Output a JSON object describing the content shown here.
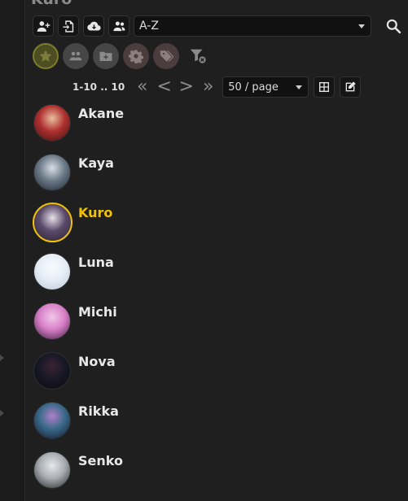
{
  "window": {
    "title": "Kuro"
  },
  "toolbar": {
    "sort_value": "A-Z",
    "buttons": [
      "add-user-icon",
      "import-icon",
      "cloud-download-icon",
      "group-icon"
    ]
  },
  "filters": {
    "tags": [
      {
        "name": "favorite",
        "icon": "star-icon",
        "color": "#4f4f2a"
      },
      {
        "name": "groups",
        "icon": "group-icon",
        "color": "#4a4a4a"
      },
      {
        "name": "folder",
        "icon": "folder-plus-icon",
        "color": "#4a4a4a"
      },
      {
        "name": "settings",
        "icon": "gear-icon",
        "color": "#4d3e3e"
      },
      {
        "name": "tags",
        "icon": "tag-icon",
        "color": "#4d3e3e"
      }
    ]
  },
  "pagination": {
    "range_text": "1-10 .. 10",
    "per_page": "50 / page",
    "first": "«",
    "prev": "<",
    "next": ">",
    "last": "»"
  },
  "characters": [
    {
      "name": "Akane",
      "selected": false,
      "colors": [
        "#3a1414",
        "#b03030",
        "#e8c0a0"
      ]
    },
    {
      "name": "Kaya",
      "selected": false,
      "colors": [
        "#1c2430",
        "#6c7a88",
        "#d8dde4"
      ]
    },
    {
      "name": "Kuro",
      "selected": true,
      "colors": [
        "#2a2230",
        "#5a4a6a",
        "#e8e0ea"
      ]
    },
    {
      "name": "Luna",
      "selected": false,
      "colors": [
        "#b8c8d8",
        "#e6eef6",
        "#f8fbff"
      ]
    },
    {
      "name": "Michi",
      "selected": false,
      "colors": [
        "#3a1a3a",
        "#d880c8",
        "#f0c8e8"
      ]
    },
    {
      "name": "Nova",
      "selected": false,
      "colors": [
        "#0c0c10",
        "#181826",
        "#3a2434"
      ]
    },
    {
      "name": "Rikka",
      "selected": false,
      "colors": [
        "#101828",
        "#3a6a8a",
        "#b080c8"
      ]
    },
    {
      "name": "Senko",
      "selected": false,
      "colors": [
        "#202224",
        "#a8adb2",
        "#e6e8ea"
      ]
    }
  ]
}
